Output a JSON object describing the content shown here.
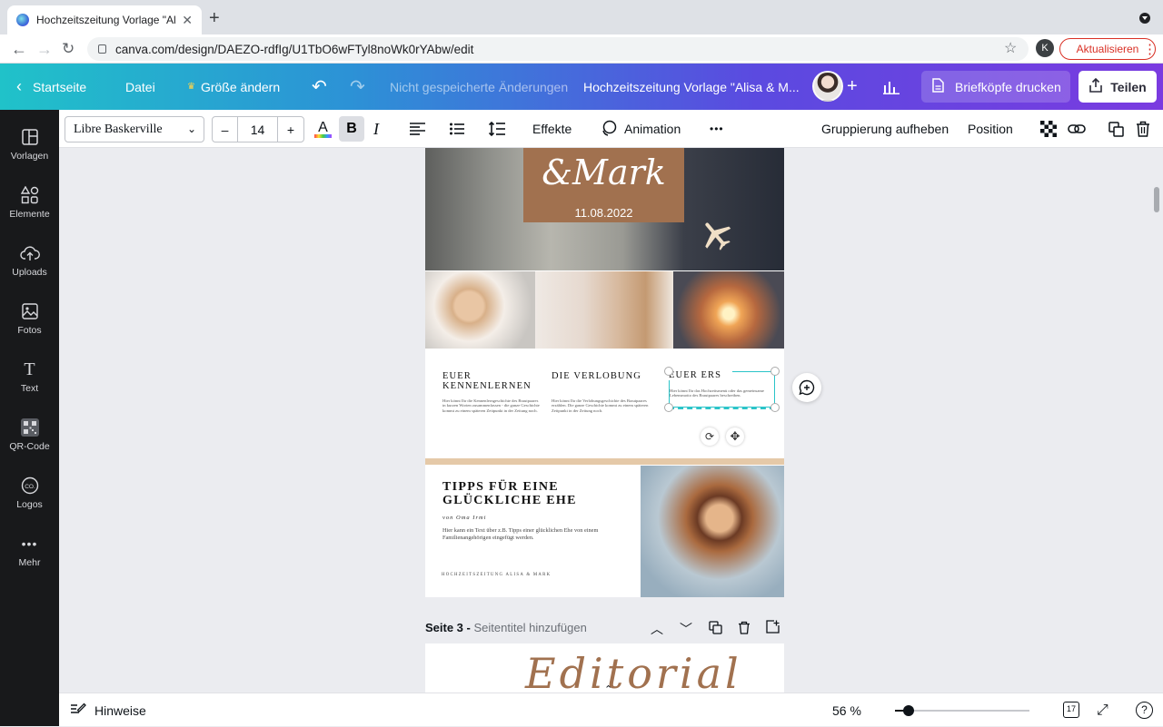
{
  "browser": {
    "tab_title": "Hochzeitszeitung Vorlage \"Alisa",
    "url": "canva.com/design/DAEZO-rdfIg/U1TbO6wFTyl8noWk0rYAbw/edit",
    "profile_initial": "K",
    "update_label": "Aktualisieren"
  },
  "header": {
    "home": "Startseite",
    "file": "Datei",
    "resize": "Größe ändern",
    "save_status": "Nicht gespeicherte Änderungen",
    "design_title": "Hochzeitszeitung Vorlage \"Alisa & M...",
    "print_label": "Briefköpfe drucken",
    "share_label": "Teilen"
  },
  "sidebar": {
    "items": [
      {
        "label": "Vorlagen",
        "icon": "templates-icon"
      },
      {
        "label": "Elemente",
        "icon": "elements-icon"
      },
      {
        "label": "Uploads",
        "icon": "upload-icon"
      },
      {
        "label": "Fotos",
        "icon": "photo-icon"
      },
      {
        "label": "Text",
        "icon": "text-icon"
      },
      {
        "label": "QR-Code",
        "icon": "qr-code-icon"
      },
      {
        "label": "Logos",
        "icon": "logos-icon"
      },
      {
        "label": "Mehr",
        "icon": "more-icon"
      }
    ]
  },
  "toolbar": {
    "font": "Libre Baskerville",
    "minus": "–",
    "size": "14",
    "plus": "+",
    "text_color_letter": "A",
    "bold_letter": "B",
    "italic_letter": "I",
    "effects": "Effekte",
    "animation": "Animation",
    "more": "•••",
    "ungroup": "Gruppierung aufheben",
    "position": "Position"
  },
  "page": {
    "name_script": "&Mark",
    "date": "11.08.2022",
    "col1_title": "EUER KENNENLERNEN",
    "col1_text": "Hier könnt Ihr die Kennenlerngeschichte des Brautpaares in kurzen Worten zusammenfassen - die ganze Geschichte kommt zu einem späteren Zeitpunkt in der Zeitung noch.",
    "col2_title": "DIE VERLOBUNG",
    "col2_text": "Hier könnt Ihr die Verlobungsgeschichte des Brautpaares erzählen. Die ganze Geschichte kommt zu einem späteren Zeitpunkt in der Zeitung noch.",
    "col3_title": "EUER ERS",
    "col3_text": "Hier könnt Ihr das Hochzeitsmenü oder das gemeinsame Lebensmotto des Brautpaares beschreiben.",
    "tips_title": "TIPPS FÜR EINE GLÜCKLICHE EHE",
    "tips_byline": "von Oma Irmi",
    "tips_text": "Hier kann ein Text über z.B. Tipps einer glücklichen Ehe von einem Familienangehörigen eingefügt werden.",
    "footer": "HOCHZEITSZEITUNG ALISA & MARK"
  },
  "page3": {
    "label": "Seite 3 -",
    "title_placeholder": "Seitentitel hinzufügen",
    "script_peek": "Editorial"
  },
  "bottom": {
    "notes": "Hinweise",
    "zoom": "56 %",
    "zoom_fraction": 0.1,
    "page_count": "17"
  },
  "colors": {
    "accent_brown": "#a1714f",
    "selection_teal": "#2bc4c9",
    "share_text": "#2b2b38",
    "update_red": "#d93025"
  }
}
